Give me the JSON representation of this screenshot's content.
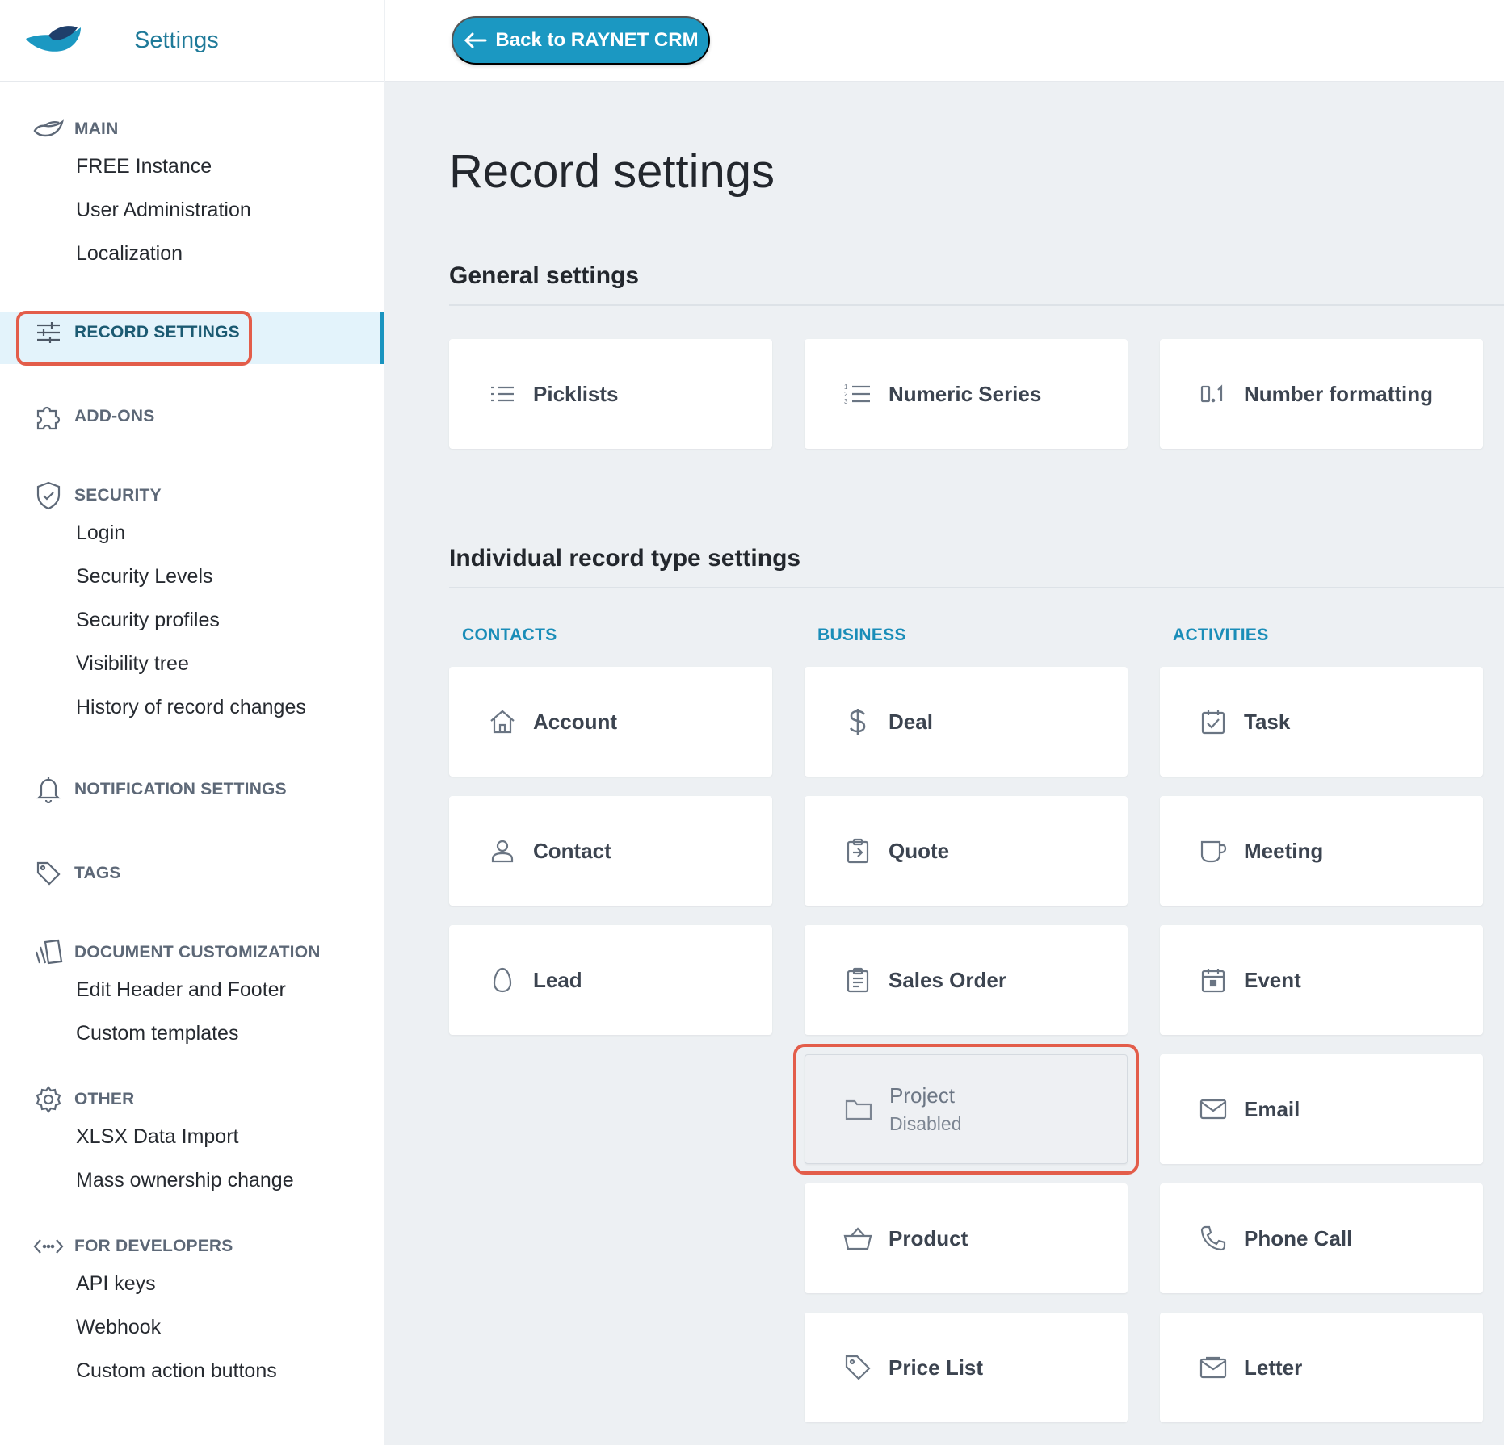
{
  "app": {
    "title": "Settings"
  },
  "topbar": {
    "back_label": "Back to RAYNET CRM"
  },
  "sidebar": {
    "sections": [
      {
        "label": "MAIN",
        "icon": "fish-icon",
        "items": [
          "FREE Instance",
          "User Administration",
          "Localization"
        ]
      },
      {
        "label": "RECORD SETTINGS",
        "icon": "sliders-icon",
        "items": [],
        "active": true
      },
      {
        "label": "ADD-ONS",
        "icon": "puzzle-icon",
        "items": []
      },
      {
        "label": "SECURITY",
        "icon": "shield-check-icon",
        "items": [
          "Login",
          "Security Levels",
          "Security profiles",
          "Visibility tree",
          "History of record changes"
        ]
      },
      {
        "label": "NOTIFICATION SETTINGS",
        "icon": "bell-icon",
        "items": []
      },
      {
        "label": "TAGS",
        "icon": "tag-icon",
        "items": []
      },
      {
        "label": "DOCUMENT CUSTOMIZATION",
        "icon": "documents-icon",
        "items": [
          "Edit Header and Footer",
          "Custom templates"
        ]
      },
      {
        "label": "OTHER",
        "icon": "gear-icon",
        "items": [
          "XLSX Data Import",
          "Mass ownership change"
        ]
      },
      {
        "label": "FOR DEVELOPERS",
        "icon": "code-icon",
        "items": [
          "API keys",
          "Webhook",
          "Custom action buttons"
        ]
      }
    ]
  },
  "main": {
    "title": "Record settings",
    "general": {
      "title": "General settings",
      "cards": [
        {
          "label": "Picklists",
          "icon": "list-icon"
        },
        {
          "label": "Numeric Series",
          "icon": "numbered-list-icon"
        },
        {
          "label": "Number formatting",
          "icon": "number-format-icon"
        }
      ]
    },
    "individual": {
      "title": "Individual record type settings",
      "columns": [
        {
          "label": "CONTACTS",
          "cards": [
            {
              "label": "Account",
              "icon": "home-icon"
            },
            {
              "label": "Contact",
              "icon": "person-icon"
            },
            {
              "label": "Lead",
              "icon": "egg-icon"
            }
          ]
        },
        {
          "label": "BUSINESS",
          "cards": [
            {
              "label": "Deal",
              "icon": "dollar-icon"
            },
            {
              "label": "Quote",
              "icon": "quote-clipboard-icon"
            },
            {
              "label": "Sales Order",
              "icon": "clipboard-list-icon"
            },
            {
              "label": "Project",
              "icon": "folder-icon",
              "status": "Disabled"
            },
            {
              "label": "Product",
              "icon": "basket-icon"
            },
            {
              "label": "Price List",
              "icon": "tag-icon"
            }
          ]
        },
        {
          "label": "ACTIVITIES",
          "cards": [
            {
              "label": "Task",
              "icon": "checkbox-icon"
            },
            {
              "label": "Meeting",
              "icon": "cup-icon"
            },
            {
              "label": "Event",
              "icon": "calendar-icon"
            },
            {
              "label": "Email",
              "icon": "envelope-icon"
            },
            {
              "label": "Phone Call",
              "icon": "phone-icon"
            },
            {
              "label": "Letter",
              "icon": "letter-icon"
            }
          ]
        }
      ]
    }
  },
  "colors": {
    "accent": "#1b98c2",
    "highlight": "#e35d4a",
    "active_bg": "#e3f3fb"
  }
}
